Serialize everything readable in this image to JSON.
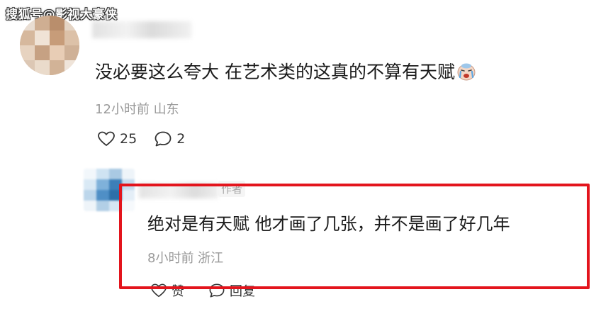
{
  "watermark": {
    "text": "搜狐号@影视大豪侠"
  },
  "comment_1": {
    "text": "没必要这么夸大 在艺术类的这真的不算有天赋",
    "emoji_icon": "crying-face-icon",
    "meta": "12小时前 山东",
    "like_count": "25",
    "reply_count": "2"
  },
  "comment_2": {
    "author_tag": "作者",
    "text": "绝对是有天赋 他才画了几张，并不是画了好几年",
    "meta": "8小时前 浙江",
    "like_label": "赞",
    "reply_label": "回复"
  },
  "colors": {
    "highlight": "#e3141c",
    "meta_gray": "#9a9a9a"
  }
}
